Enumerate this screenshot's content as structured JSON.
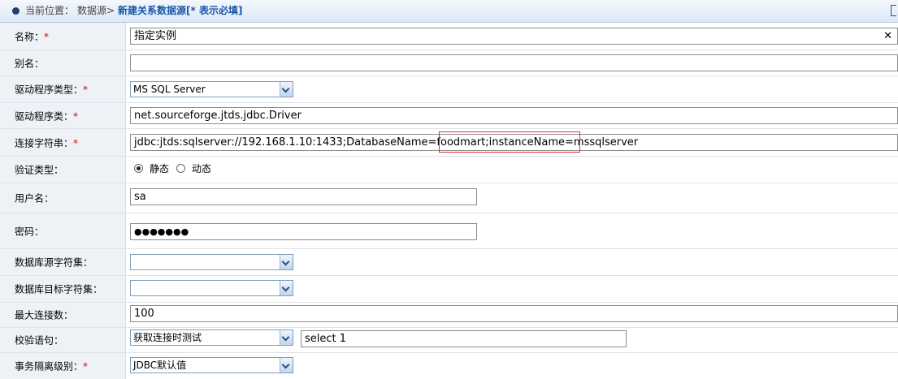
{
  "breadcrumb": {
    "location_label": "当前位置：",
    "datasource": "数据源>",
    "title": "新建关系数据源",
    "required_hint": "[* 表示必填]"
  },
  "form": {
    "name": {
      "label": "名称：",
      "required": "*",
      "value": "指定实例"
    },
    "alias": {
      "label": "别名：",
      "value": ""
    },
    "driver_type": {
      "label": "驱动程序类型：",
      "required": "*",
      "value": "MS SQL Server"
    },
    "driver_class": {
      "label": "驱动程序类：",
      "required": "*",
      "value": "net.sourceforge.jtds.jdbc.Driver"
    },
    "connection_string": {
      "label": "连接字符串：",
      "required": "*",
      "value": "jdbc:jtds:sqlserver://192.168.1.10:1433;DatabaseName=foodmart;instanceName=mssqlserver"
    },
    "auth_type": {
      "label": "验证类型：",
      "option_static": "静态",
      "option_dynamic": "动态",
      "selected": "静态"
    },
    "username": {
      "label": "用户名：",
      "value": "sa"
    },
    "password": {
      "label": "密码：",
      "value": "●●●●●●●"
    },
    "source_charset": {
      "label": "数据库源字符集：",
      "value": ""
    },
    "target_charset": {
      "label": "数据库目标字符集：",
      "value": ""
    },
    "max_connections": {
      "label": "最大连接数：",
      "value": "100"
    },
    "validation": {
      "label": "校验语句：",
      "mode": "获取连接时测试",
      "sql": "select 1"
    },
    "isolation": {
      "label": "事务隔离级别：",
      "required": "*",
      "value": "JDBC默认值"
    }
  },
  "colors": {
    "highlight": "#e03030",
    "required": "#dd0000",
    "title": "#1a56a8"
  }
}
